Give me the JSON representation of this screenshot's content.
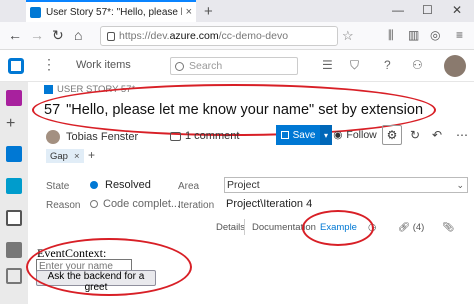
{
  "browser": {
    "tab_title": "User Story 57*: \"Hello, please l",
    "tab_close": "×",
    "new_tab": "+",
    "url_prefix": "https://dev.",
    "url_domain": "azure.com",
    "url_suffix": "/cc-demo-devo",
    "window_controls": [
      "—",
      "☐",
      "✕"
    ]
  },
  "header": {
    "breadcrumb": "Work items",
    "search_placeholder": "Search"
  },
  "work_item": {
    "type_label": "USER STORY 57*",
    "id": "57",
    "title": "\"Hello, please let me know your name\" set by extension",
    "owner": "Tobias Fenster",
    "comments": "1 comment",
    "save_label": "Save",
    "follow_label": "Follow",
    "tag": "Gap",
    "tag_remove": "×",
    "tag_add": "+"
  },
  "fields": {
    "state_label": "State",
    "state_value": "Resolved",
    "reason_label": "Reason",
    "reason_value": "Code complet...",
    "area_label": "Area",
    "area_value": "Project",
    "iteration_label": "Iteration",
    "iteration_value": "Project\\Iteration 4"
  },
  "page_tabs": {
    "details": "Details",
    "documentation": "Documentation",
    "example": "Example",
    "links": "(4)"
  },
  "extension": {
    "label": "EventContext:",
    "input_placeholder": "Enter your name",
    "button_label": "Ask the backend for a greet"
  },
  "colors": {
    "accent": "#0078d4",
    "annotation": "#d81f26",
    "state_resolved": "#0078d4"
  }
}
